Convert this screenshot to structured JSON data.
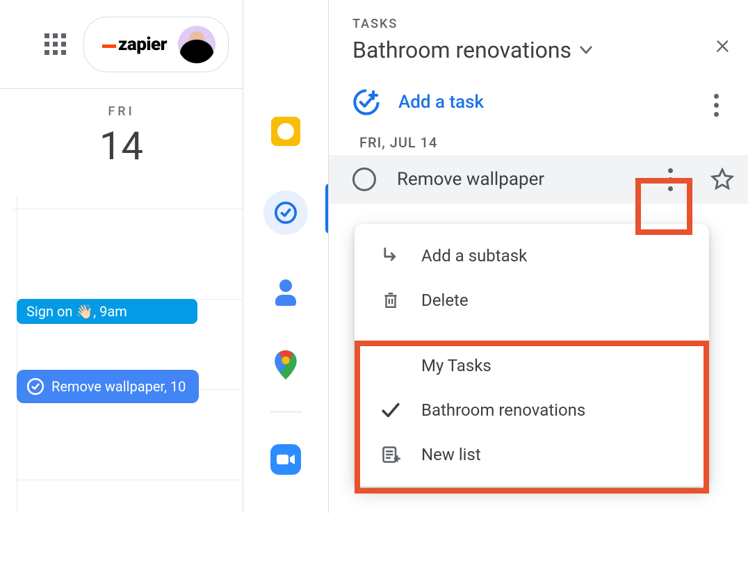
{
  "header": {
    "workspace_brand": "zapier"
  },
  "calendar": {
    "dow": "FRI",
    "day": "14",
    "events": [
      {
        "title": "Sign on 👋🏻, 9am"
      },
      {
        "title": "Remove wallpaper, 10"
      }
    ]
  },
  "panel": {
    "label": "TASKS",
    "list_title": "Bathroom renovations",
    "add_label": "Add a task",
    "date_header": "FRI, JUL 14",
    "task_title": "Remove wallpaper"
  },
  "menu": {
    "add_subtask": "Add a subtask",
    "delete": "Delete",
    "my_tasks": "My Tasks",
    "current_list": "Bathroom renovations",
    "new_list": "New list"
  }
}
